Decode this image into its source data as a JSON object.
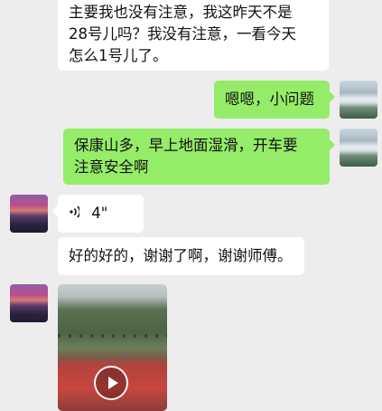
{
  "messages": [
    {
      "lines": [
        "主要我也没有注意，我这昨天不是",
        "28号儿吗？我没有注意，一看今天",
        "怎么1号儿了。"
      ]
    },
    {
      "text": "嗯嗯，小问题"
    },
    {
      "lines": [
        "保康山多，早上地面湿滑，开车要",
        "注意安全啊"
      ]
    },
    {
      "voice_duration": "4\""
    },
    {
      "text": "好的好的，谢谢了啊，谢谢师傅。"
    }
  ],
  "colors": {
    "incoming": "#ffffff",
    "outgoing": "#95ec69",
    "background": "#ededed"
  },
  "icons": {
    "voice": "voice-wave-icon",
    "video": "play-icon"
  }
}
